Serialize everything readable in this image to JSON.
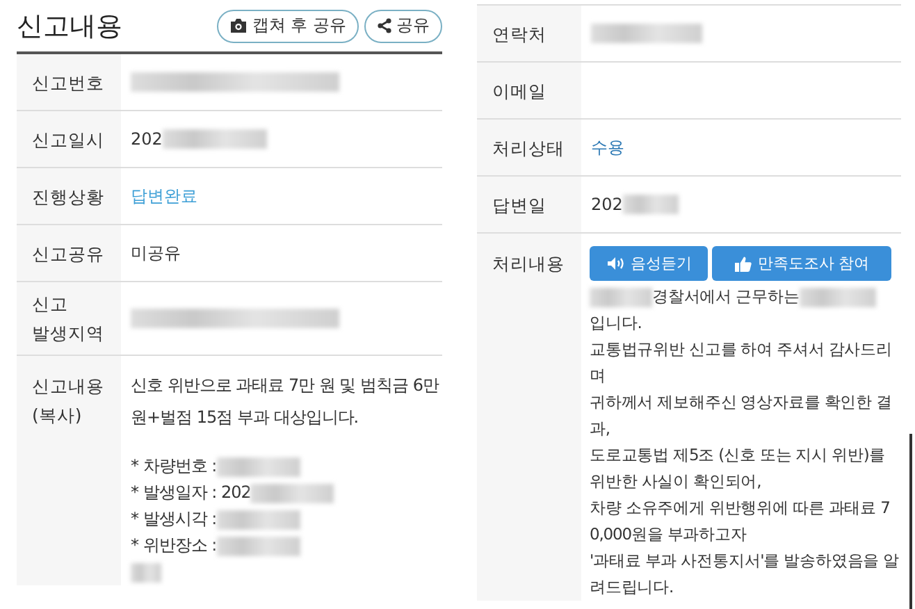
{
  "left_panel": {
    "title": "신고내용",
    "buttons": [
      {
        "label": "캡쳐 후 공유"
      },
      {
        "label": "공유"
      }
    ],
    "rows": [
      {
        "label": "신고번호",
        "kind": "redacted"
      },
      {
        "label": "신고일시",
        "kind": "text",
        "value": "202",
        "redacted": true
      },
      {
        "label": "진행상황",
        "kind": "link",
        "value": "답변완료"
      },
      {
        "label": "신고공유",
        "kind": "text",
        "value": "미공유"
      },
      {
        "label": "신고\n발생지역",
        "kind": "redacted"
      },
      {
        "label": "신고내용\n(복사)",
        "kind": "lines",
        "lines": [
          {
            "text": "신호 위반으로 과태료 7만 원 및 범칙금 6만"
          },
          {
            "text": "원+벌점 15점 부과 대상입니다."
          },
          {
            "kind": "gap"
          },
          {
            "text": "* 차량번호 :",
            "redacted": true
          },
          {
            "text": "* 발생일자 : 202",
            "redacted": true
          },
          {
            "text": "* 발생시각 :",
            "redacted": true
          },
          {
            "text": "* 위반장소 :",
            "redacted": true
          },
          {
            "kind": "blur"
          }
        ]
      }
    ]
  },
  "right_panel": {
    "rows": [
      {
        "label": "연락처",
        "kind": "redacted"
      },
      {
        "label": "이메일",
        "kind": "empty"
      },
      {
        "label": "처리상태",
        "kind": "link",
        "value": "수용"
      },
      {
        "label": "답변일",
        "kind": "text",
        "value": "202",
        "redacted": true
      },
      {
        "label": "처리내용",
        "kind": "answer",
        "buttons": [
          {
            "label": "음성듣기"
          },
          {
            "label": "만족도조사 참여"
          }
        ],
        "lines": [
          {
            "text": "경찰서에서 근무하는",
            "redacted_before": true,
            "redacted": true
          },
          {
            "text": "입니다."
          },
          {
            "text": "교통법규위반 신고를 하여 주셔서 감사드리"
          },
          {
            "text": "며"
          },
          {
            "text": "귀하께서 제보해주신 영상자료를 확인한 결"
          },
          {
            "text": "과,"
          },
          {
            "text": "도로교통법 제5조 (신호 또는 지시 위반)를"
          },
          {
            "text": "위반한 사실이 확인되어,"
          },
          {
            "text": "차량 소유주에게 위반행위에 따른 과태료 7"
          },
          {
            "text": "0,000원을 부과하고자"
          },
          {
            "text": "'과태료 부과 사전통지서'를 발송하였음을 알"
          },
          {
            "text": "려드립니다."
          }
        ]
      }
    ]
  }
}
